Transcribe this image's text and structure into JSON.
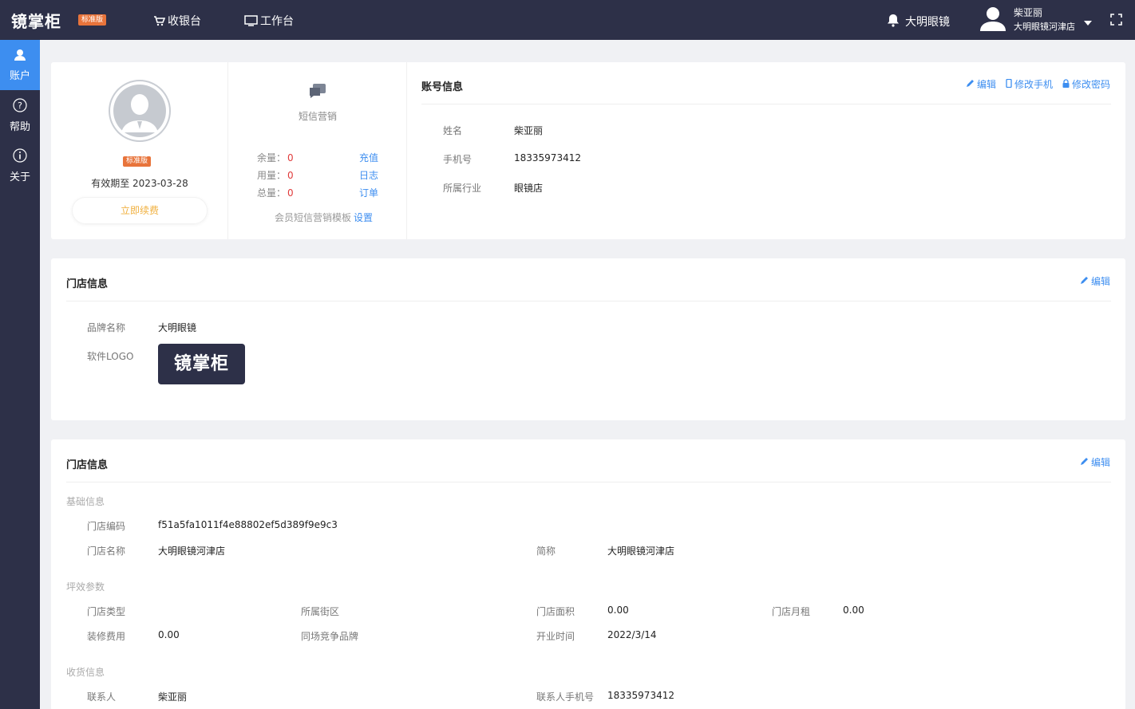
{
  "header": {
    "app_name": "镜掌柜",
    "edition_badge": "标准版",
    "nav": {
      "cashier": "收银台",
      "workbench": "工作台"
    },
    "notification_store": "大明眼镜",
    "user_name": "柴亚丽",
    "user_store": "大明眼镜河津店"
  },
  "sidebar": {
    "items": [
      {
        "label": "账户",
        "icon": "user-icon",
        "active": true
      },
      {
        "label": "帮助",
        "icon": "help-icon",
        "active": false
      },
      {
        "label": "关于",
        "icon": "info-icon",
        "active": false
      }
    ]
  },
  "profile": {
    "edition_badge": "标准版",
    "expiry": "有效期至 2023-03-28",
    "renew_label": "立即续费"
  },
  "sms": {
    "title": "短信营销",
    "balance_label": "余量：",
    "balance": "0",
    "recharge": "充值",
    "used_label": "用量：",
    "used": "0",
    "log": "日志",
    "total_label": "总量：",
    "total": "0",
    "orders": "订单",
    "template_text": "会员短信营销模板",
    "template_link": "设置"
  },
  "account": {
    "title": "账号信息",
    "edit": "编辑",
    "change_phone": "修改手机",
    "change_password": "修改密码",
    "name_label": "姓名",
    "name": "柴亚丽",
    "phone_label": "手机号",
    "phone": "18335973412",
    "industry_label": "所属行业",
    "industry": "眼镜店"
  },
  "store_brand": {
    "title": "门店信息",
    "edit": "编辑",
    "brand_label": "品牌名称",
    "brand": "大明眼镜",
    "logo_label": "软件LOGO",
    "logo_text": "镜掌柜"
  },
  "store_detail": {
    "title": "门店信息",
    "edit": "编辑",
    "basic_group": "基础信息",
    "code_label": "门店编码",
    "code": "f51a5fa1011f4e88802ef5d389f9e9c3",
    "name_label": "门店名称",
    "name": "大明眼镜河津店",
    "short_label": "简称",
    "short": "大明眼镜河津店",
    "params_group": "坪效参数",
    "type_label": "门店类型",
    "type": "",
    "district_label": "所属街区",
    "district": "",
    "area_label": "门店面积",
    "area": "0.00",
    "rent_label": "门店月租",
    "rent": "0.00",
    "decor_label": "装修费用",
    "decor": "0.00",
    "competitor_label": "同场竞争品牌",
    "competitor": "",
    "open_label": "开业时间",
    "open": "2022/3/14",
    "shipping_group": "收货信息",
    "contact_label": "联系人",
    "contact": "柴亚丽",
    "contact_phone_label": "联系人手机号",
    "contact_phone": "18335973412"
  }
}
